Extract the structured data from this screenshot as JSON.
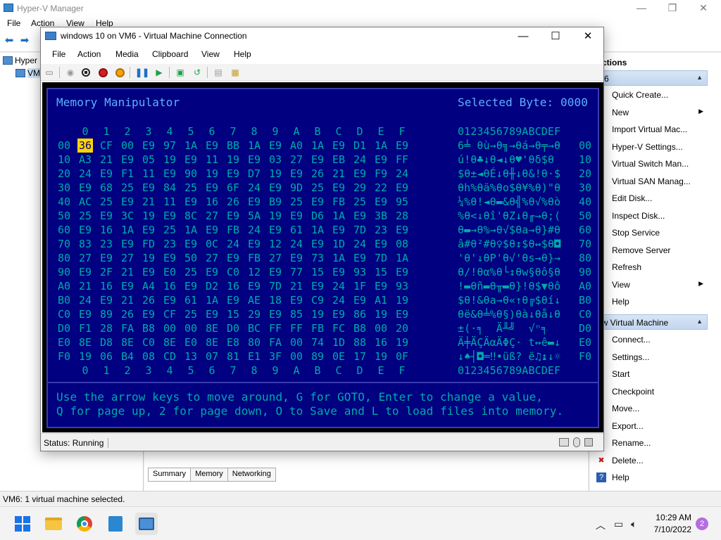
{
  "hyperv": {
    "title": "Hyper-V Manager",
    "menu": [
      "File",
      "Action",
      "View",
      "Help"
    ],
    "tree": [
      "Hyper",
      "VM"
    ],
    "actions_header": "ctions",
    "vm_section": "M6",
    "vm_actions_section": "ew Virtual Machine",
    "server_actions": [
      {
        "label": "Quick Create...",
        "icon": "quick-create-icon"
      },
      {
        "label": "New",
        "icon": "new-icon",
        "submenu": "▶"
      },
      {
        "label": "Import Virtual Mac...",
        "icon": "import-icon"
      },
      {
        "label": "Hyper-V Settings...",
        "icon": "settings-icon"
      },
      {
        "label": "Virtual Switch Man...",
        "icon": "switch-icon"
      },
      {
        "label": "Virtual SAN Manag...",
        "icon": "san-icon"
      },
      {
        "label": "Edit Disk...",
        "icon": "edit-disk-icon"
      },
      {
        "label": "Inspect Disk...",
        "icon": "inspect-disk-icon"
      },
      {
        "label": "Stop Service",
        "icon": "stop-service-icon"
      },
      {
        "label": "Remove Server",
        "icon": "remove-server-icon"
      },
      {
        "label": "Refresh",
        "icon": "refresh-icon"
      },
      {
        "label": "View",
        "icon": "view-icon",
        "submenu": "▶"
      },
      {
        "label": "Help",
        "icon": "help-icon"
      }
    ],
    "vm_actions": [
      {
        "label": "Connect...",
        "icon": "connect-icon"
      },
      {
        "label": "Settings...",
        "icon": "vm-settings-icon"
      },
      {
        "label": "Start",
        "icon": "start-icon"
      },
      {
        "label": "Checkpoint",
        "icon": "checkpoint-icon"
      },
      {
        "label": "Move...",
        "icon": "move-icon"
      },
      {
        "label": "Export...",
        "icon": "export-icon"
      },
      {
        "label": "Rename...",
        "icon": "rename-icon"
      },
      {
        "label": "Delete...",
        "icon": "delete-icon"
      },
      {
        "label": "Help",
        "icon": "help-icon"
      }
    ],
    "tabs": [
      "Summary",
      "Memory",
      "Networking"
    ],
    "status": "VM6:  1 virtual machine selected."
  },
  "vm": {
    "title": "windows 10 on VM6 - Virtual Machine Connection",
    "menu": [
      "File",
      "Action",
      "Media",
      "Clipboard",
      "View",
      "Help"
    ],
    "status": "Status: Running"
  },
  "dos": {
    "title": "Memory Manipulator",
    "selected": "Selected Byte: 0000",
    "col_headers": [
      "0",
      "1",
      "2",
      "3",
      "4",
      "5",
      "6",
      "7",
      "8",
      "9",
      "A",
      "B",
      "C",
      "D",
      "E",
      "F"
    ],
    "ascii_header": "0123456789ABCDEF",
    "rows": [
      {
        "addr": "00",
        "bytes": [
          "36",
          "CF",
          "00",
          "E9",
          "97",
          "1A",
          "E9",
          "BB",
          "1A",
          "E9",
          "A0",
          "1A",
          "E9",
          "D1",
          "1A",
          "E9"
        ],
        "ascii": "6╧ θù→θ╗→θá→θ╤→θ"
      },
      {
        "addr": "10",
        "bytes": [
          "A3",
          "21",
          "E9",
          "05",
          "19",
          "E9",
          "11",
          "19",
          "E9",
          "03",
          "27",
          "E9",
          "EB",
          "24",
          "E9",
          "FF"
        ],
        "ascii": "ú!θ♣↓θ◄↓θ♥'θδ$θ "
      },
      {
        "addr": "20",
        "bytes": [
          "24",
          "E9",
          "F1",
          "11",
          "E9",
          "90",
          "19",
          "E9",
          "D7",
          "19",
          "E9",
          "26",
          "21",
          "E9",
          "F9",
          "24"
        ],
        "ascii": "$θ±◄θÉ↓θ╫↓θ&!θ·$"
      },
      {
        "addr": "30",
        "bytes": [
          "E9",
          "68",
          "25",
          "E9",
          "84",
          "25",
          "E9",
          "6F",
          "24",
          "E9",
          "9D",
          "25",
          "E9",
          "29",
          "22",
          "E9"
        ],
        "ascii": "θh%θä%θo$θ¥%θ)\"θ"
      },
      {
        "addr": "40",
        "bytes": [
          "AC",
          "25",
          "E9",
          "21",
          "11",
          "E9",
          "16",
          "26",
          "E9",
          "B9",
          "25",
          "E9",
          "FB",
          "25",
          "E9",
          "95"
        ],
        "ascii": "¼%θ!◄θ▬&θ╣%θ√%θò"
      },
      {
        "addr": "50",
        "bytes": [
          "25",
          "E9",
          "3C",
          "19",
          "E9",
          "8C",
          "27",
          "E9",
          "5A",
          "19",
          "E9",
          "D6",
          "1A",
          "E9",
          "3B",
          "28"
        ],
        "ascii": "%θ<↓θî'θZ↓θ╓→θ;("
      },
      {
        "addr": "60",
        "bytes": [
          "E9",
          "16",
          "1A",
          "E9",
          "25",
          "1A",
          "E9",
          "FB",
          "24",
          "E9",
          "61",
          "1A",
          "E9",
          "7D",
          "23",
          "E9"
        ],
        "ascii": "θ▬→θ%→θ√$θa→θ}#θ"
      },
      {
        "addr": "70",
        "bytes": [
          "83",
          "23",
          "E9",
          "FD",
          "23",
          "E9",
          "0C",
          "24",
          "E9",
          "12",
          "24",
          "E9",
          "1D",
          "24",
          "E9",
          "08"
        ],
        "ascii": "â#θ²#θ♀$θ↕$θ↔$θ◘"
      },
      {
        "addr": "80",
        "bytes": [
          "27",
          "E9",
          "27",
          "19",
          "E9",
          "50",
          "27",
          "E9",
          "FB",
          "27",
          "E9",
          "73",
          "1A",
          "E9",
          "7D",
          "1A"
        ],
        "ascii": "'θ'↓θP'θ√'θs→θ}→"
      },
      {
        "addr": "90",
        "bytes": [
          "E9",
          "2F",
          "21",
          "E9",
          "E0",
          "25",
          "E9",
          "C0",
          "12",
          "E9",
          "77",
          "15",
          "E9",
          "93",
          "15",
          "E9"
        ],
        "ascii": "θ/!θα%θ└↕θw§θô§θ"
      },
      {
        "addr": "A0",
        "bytes": [
          "21",
          "16",
          "E9",
          "A4",
          "16",
          "E9",
          "D2",
          "16",
          "E9",
          "7D",
          "21",
          "E9",
          "24",
          "1F",
          "E9",
          "93"
        ],
        "ascii": "!▬θñ▬θ╥▬θ}!θ$▼θô"
      },
      {
        "addr": "B0",
        "bytes": [
          "24",
          "E9",
          "21",
          "26",
          "E9",
          "61",
          "1A",
          "E9",
          "AE",
          "18",
          "E9",
          "C9",
          "24",
          "E9",
          "A1",
          "19"
        ],
        "ascii": "$θ!&θa→θ«↑θ╔$θí↓"
      },
      {
        "addr": "C0",
        "bytes": [
          "E9",
          "89",
          "26",
          "E9",
          "CF",
          "25",
          "E9",
          "15",
          "29",
          "E9",
          "85",
          "19",
          "E9",
          "86",
          "19",
          "E9"
        ],
        "ascii": "θë&θ╧%θ§)θà↓θå↓θ"
      },
      {
        "addr": "D0",
        "bytes": [
          "F1",
          "28",
          "FA",
          "B8",
          "00",
          "00",
          "8E",
          "D0",
          "BC",
          "FF",
          "FF",
          "FB",
          "FC",
          "B8",
          "00",
          "20"
        ],
        "ascii": "±(·╕  Ä╨╝  √ⁿ╕  "
      },
      {
        "addr": "E0",
        "bytes": [
          "8E",
          "D8",
          "8E",
          "C0",
          "8E",
          "E0",
          "8E",
          "E8",
          "80",
          "FA",
          "00",
          "74",
          "1D",
          "88",
          "16",
          "19"
        ],
        "ascii": "Ä╪ÄÇÄαÄΦÇ· t↔ê▬↓"
      },
      {
        "addr": "F0",
        "bytes": [
          "19",
          "06",
          "B4",
          "08",
          "CD",
          "13",
          "07",
          "81",
          "E1",
          "3F",
          "00",
          "89",
          "0E",
          "17",
          "19",
          "0F"
        ],
        "ascii": "↓♠┤◘═‼•üß? ë♫↨↓☼"
      }
    ],
    "help_line1": "Use the arrow keys to move around, G for GOTO, Enter to change a value,",
    "help_line2": "Q for page up, 2 for page down, O to Save and L to load files into memory."
  },
  "taskbar": {
    "time": "10:29 AM",
    "date": "7/10/2022",
    "notifications": "2"
  }
}
